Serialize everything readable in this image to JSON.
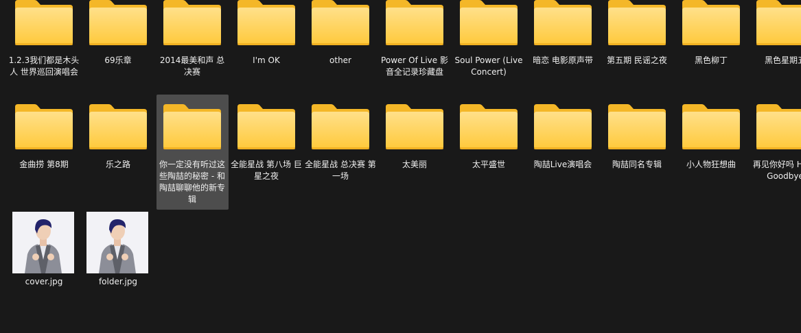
{
  "folders_row1": [
    {
      "name": "1.2.3我们都是木头人 世界巡回演唱会"
    },
    {
      "name": "69乐章"
    },
    {
      "name": "2014最美和声 总决赛"
    },
    {
      "name": "I'm OK"
    },
    {
      "name": "other"
    },
    {
      "name": "Power Of Live 影音全记录珍藏盘"
    },
    {
      "name": "Soul Power (Live Concert)"
    },
    {
      "name": "暗恋 电影原声带"
    },
    {
      "name": "第五期 民谣之夜"
    },
    {
      "name": "黑色柳丁"
    },
    {
      "name": "黑色星期五"
    }
  ],
  "folders_row2": [
    {
      "name": "金曲捞 第8期"
    },
    {
      "name": "乐之路"
    },
    {
      "name": "你一定没有听过这些陶喆的秘密 - 和陶喆聊聊他的新专辑"
    },
    {
      "name": "全能星战 第八场 巨星之夜"
    },
    {
      "name": "全能星战 总决赛 第一场"
    },
    {
      "name": "太美丽"
    },
    {
      "name": "太平盛世"
    },
    {
      "name": "陶喆Live演唱会"
    },
    {
      "name": "陶喆同名专辑"
    },
    {
      "name": "小人物狂想曲"
    },
    {
      "name": "再见你好吗 Hello Goodbye"
    }
  ],
  "files": [
    {
      "name": "cover.jpg"
    },
    {
      "name": "folder.jpg"
    }
  ],
  "selected_folder": "你一定没有听过这些陶喆的秘密 - 和陶喆聊聊他的新专辑",
  "colors": {
    "background": "#191919",
    "selection": "#4d4d4d",
    "folder_front": "#ffd25c",
    "folder_back": "#f4b728",
    "text": "#f0f0f0"
  }
}
